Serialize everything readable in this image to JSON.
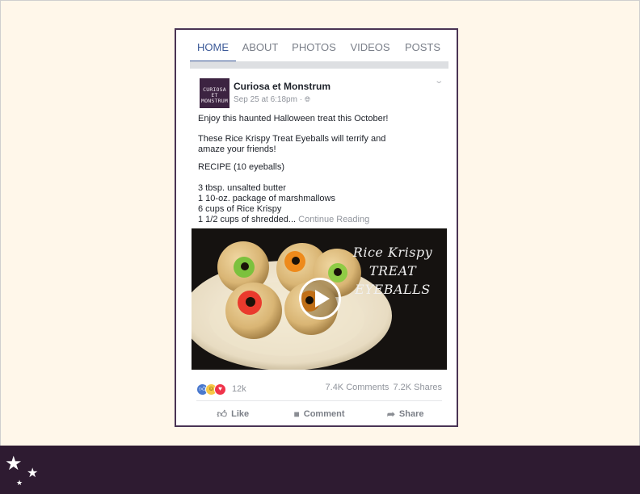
{
  "tabs": [
    {
      "label": "HOME",
      "active": true
    },
    {
      "label": "ABOUT"
    },
    {
      "label": "PHOTOS"
    },
    {
      "label": "VIDEOS"
    },
    {
      "label": "POSTS"
    }
  ],
  "post": {
    "avatar_text": "CURIOSA ET MONSTRUM",
    "page_name": "Curiosa et Monstrum",
    "timestamp": "Sep 25 at 6:18pm ·",
    "line1": "Enjoy this haunted Halloween treat this October!",
    "line2": "These Rice Krispy Treat Eyeballs will terrify and amaze your friends!",
    "recipe_title": "RECIPE (10 eyeballs)",
    "ingredients": [
      "3 tbsp. unsalted butter",
      "1 10-oz. package of marshmallows",
      "6 cups of Rice Krispy",
      "1 1/2 cups of shredded..."
    ],
    "continue_label": "Continue Reading"
  },
  "video": {
    "title_line1": "Rice Krispy",
    "title_line2": "TREAT",
    "title_line3": "EYEBALLS"
  },
  "stats": {
    "reaction_count": "12k",
    "comments": "7.4K Comments",
    "shares": "7.2K Shares"
  },
  "actions": {
    "like": "Like",
    "comment": "Comment",
    "share": "Share"
  },
  "colors": {
    "background": "#fff7ea",
    "band": "#2e1b31",
    "facebook_blue": "#3b5998",
    "frame": "#4a3454"
  },
  "icons": [
    "globe-icon",
    "chevron-down-icon",
    "thumbs-up-icon",
    "comment-icon",
    "share-icon",
    "play-icon",
    "star-icon"
  ]
}
